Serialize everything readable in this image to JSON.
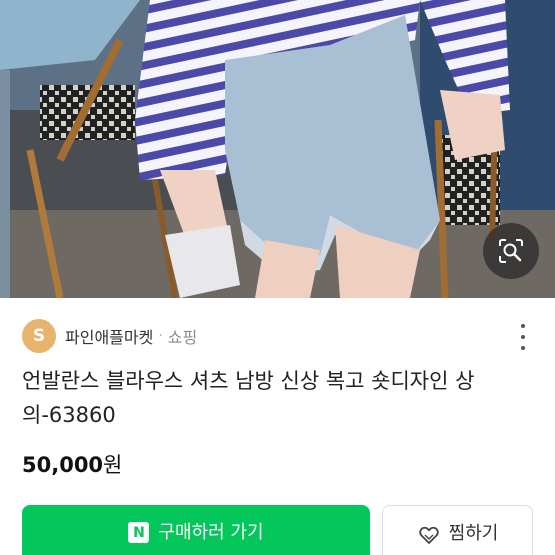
{
  "product_image": {
    "alt_icon": "image-search-icon"
  },
  "store": {
    "avatar_letter": "S",
    "name": "파인애플마켓",
    "separator": "·",
    "category": "쇼핑"
  },
  "product": {
    "title": "언발란스 블라우스 셔츠 남방 신상 복고 숏디자인 상의-63860",
    "price_value": "50,000",
    "price_unit": "원"
  },
  "actions": {
    "buy_badge": "N",
    "buy_label": "구매하러 가기",
    "wish_label": "찜하기"
  },
  "colors": {
    "brand_green": "#03c75a",
    "avatar": "#e7b36d"
  }
}
